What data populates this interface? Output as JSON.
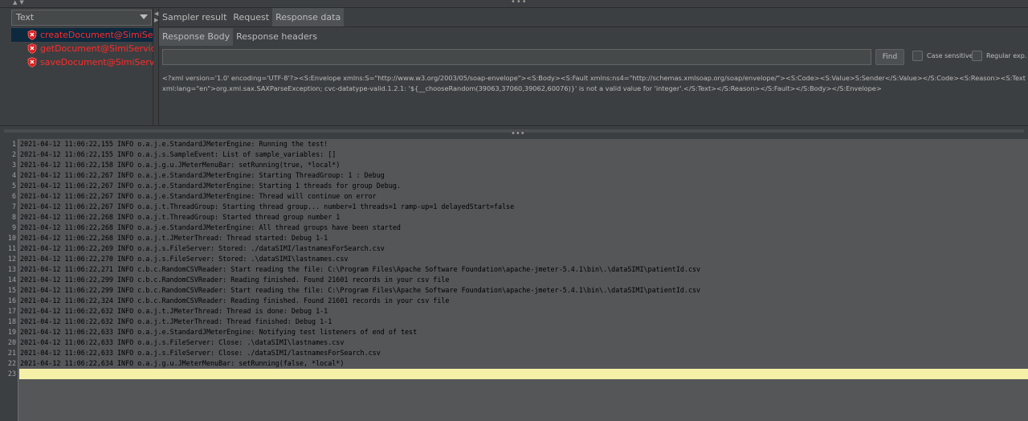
{
  "renderer": {
    "selected": "Text"
  },
  "tree": {
    "items": [
      {
        "label": "createDocument@SimiService.wsdl",
        "selected": true
      },
      {
        "label": "getDocument@SimiService.wsdl",
        "selected": false
      },
      {
        "label": "saveDocument@SimiService.wsdl",
        "selected": false
      }
    ]
  },
  "tabs": [
    "Sampler result",
    "Request",
    "Response data"
  ],
  "subtabs": [
    "Response Body",
    "Response headers"
  ],
  "search": {
    "find_label": "Find",
    "case_sensitive": "Case sensitive",
    "regular_exp": "Regular exp."
  },
  "response": {
    "text": "<?xml version='1.0' encoding='UTF-8'?><S:Envelope xmlns:S=\"http://www.w3.org/2003/05/soap-envelope\"><S:Body><S:Fault xmlns:ns4=\"http://schemas.xmlsoap.org/soap/envelope/\"><S:Code><S:Value>S:Sender</S:Value></S:Code><S:Reason><S:Text xml:lang=\"en\">org.xml.sax.SAXParseException; cvc-datatype-valid.1.2.1: '${__chooseRandom(39063,37060,39062,60076)}' is not a valid value for 'integer'.</S:Text></S:Reason></S:Fault></S:Body></S:Envelope>"
  },
  "log": {
    "lines": [
      "2021-04-12 11:06:22,155 INFO o.a.j.e.StandardJMeterEngine: Running the test!",
      "2021-04-12 11:06:22,155 INFO o.a.j.s.SampleEvent: List of sample_variables: []",
      "2021-04-12 11:06:22,158 INFO o.a.j.g.u.JMeterMenuBar: setRunning(true, *local*)",
      "2021-04-12 11:06:22,267 INFO o.a.j.e.StandardJMeterEngine: Starting ThreadGroup: 1 : Debug",
      "2021-04-12 11:06:22,267 INFO o.a.j.e.StandardJMeterEngine: Starting 1 threads for group Debug.",
      "2021-04-12 11:06:22,267 INFO o.a.j.e.StandardJMeterEngine: Thread will continue on error",
      "2021-04-12 11:06:22,267 INFO o.a.j.t.ThreadGroup: Starting thread group... number=1 threads=1 ramp-up=1 delayedStart=false",
      "2021-04-12 11:06:22,268 INFO o.a.j.t.ThreadGroup: Started thread group number 1",
      "2021-04-12 11:06:22,268 INFO o.a.j.e.StandardJMeterEngine: All thread groups have been started",
      "2021-04-12 11:06:22,268 INFO o.a.j.t.JMeterThread: Thread started: Debug 1-1",
      "2021-04-12 11:06:22,269 INFO o.a.j.s.FileServer: Stored: ./dataSIMI/lastnamesForSearch.csv",
      "2021-04-12 11:06:22,270 INFO o.a.j.s.FileServer: Stored: .\\dataSIMI\\lastnames.csv",
      "2021-04-12 11:06:22,271 INFO c.b.c.RandomCSVReader: Start reading the file: C:\\Program Files\\Apache Software Foundation\\apache-jmeter-5.4.1\\bin\\.\\dataSIMI\\patientId.csv",
      "2021-04-12 11:06:22,299 INFO c.b.c.RandomCSVReader: Reading finished. Found 21601 records in your csv file",
      "2021-04-12 11:06:22,299 INFO c.b.c.RandomCSVReader: Start reading the file: C:\\Program Files\\Apache Software Foundation\\apache-jmeter-5.4.1\\bin\\.\\dataSIMI\\patientId.csv",
      "2021-04-12 11:06:22,324 INFO c.b.c.RandomCSVReader: Reading finished. Found 21601 records in your csv file",
      "2021-04-12 11:06:22,632 INFO o.a.j.t.JMeterThread: Thread is done: Debug 1-1",
      "2021-04-12 11:06:22,632 INFO o.a.j.t.JMeterThread: Thread finished: Debug 1-1",
      "2021-04-12 11:06:22,633 INFO o.a.j.e.StandardJMeterEngine: Notifying test listeners of end of test",
      "2021-04-12 11:06:22,633 INFO o.a.j.s.FileServer: Close: .\\dataSIMI\\lastnames.csv",
      "2021-04-12 11:06:22,633 INFO o.a.j.s.FileServer: Close: ./dataSIMI/lastnamesForSearch.csv",
      "2021-04-12 11:06:22,634 INFO o.a.j.g.u.JMeterMenuBar: setRunning(false, *local*)",
      ""
    ]
  },
  "colors": {
    "error_text": "#ff2b2b",
    "current_line": "#f4f0a8",
    "selection": "#0d293e"
  }
}
